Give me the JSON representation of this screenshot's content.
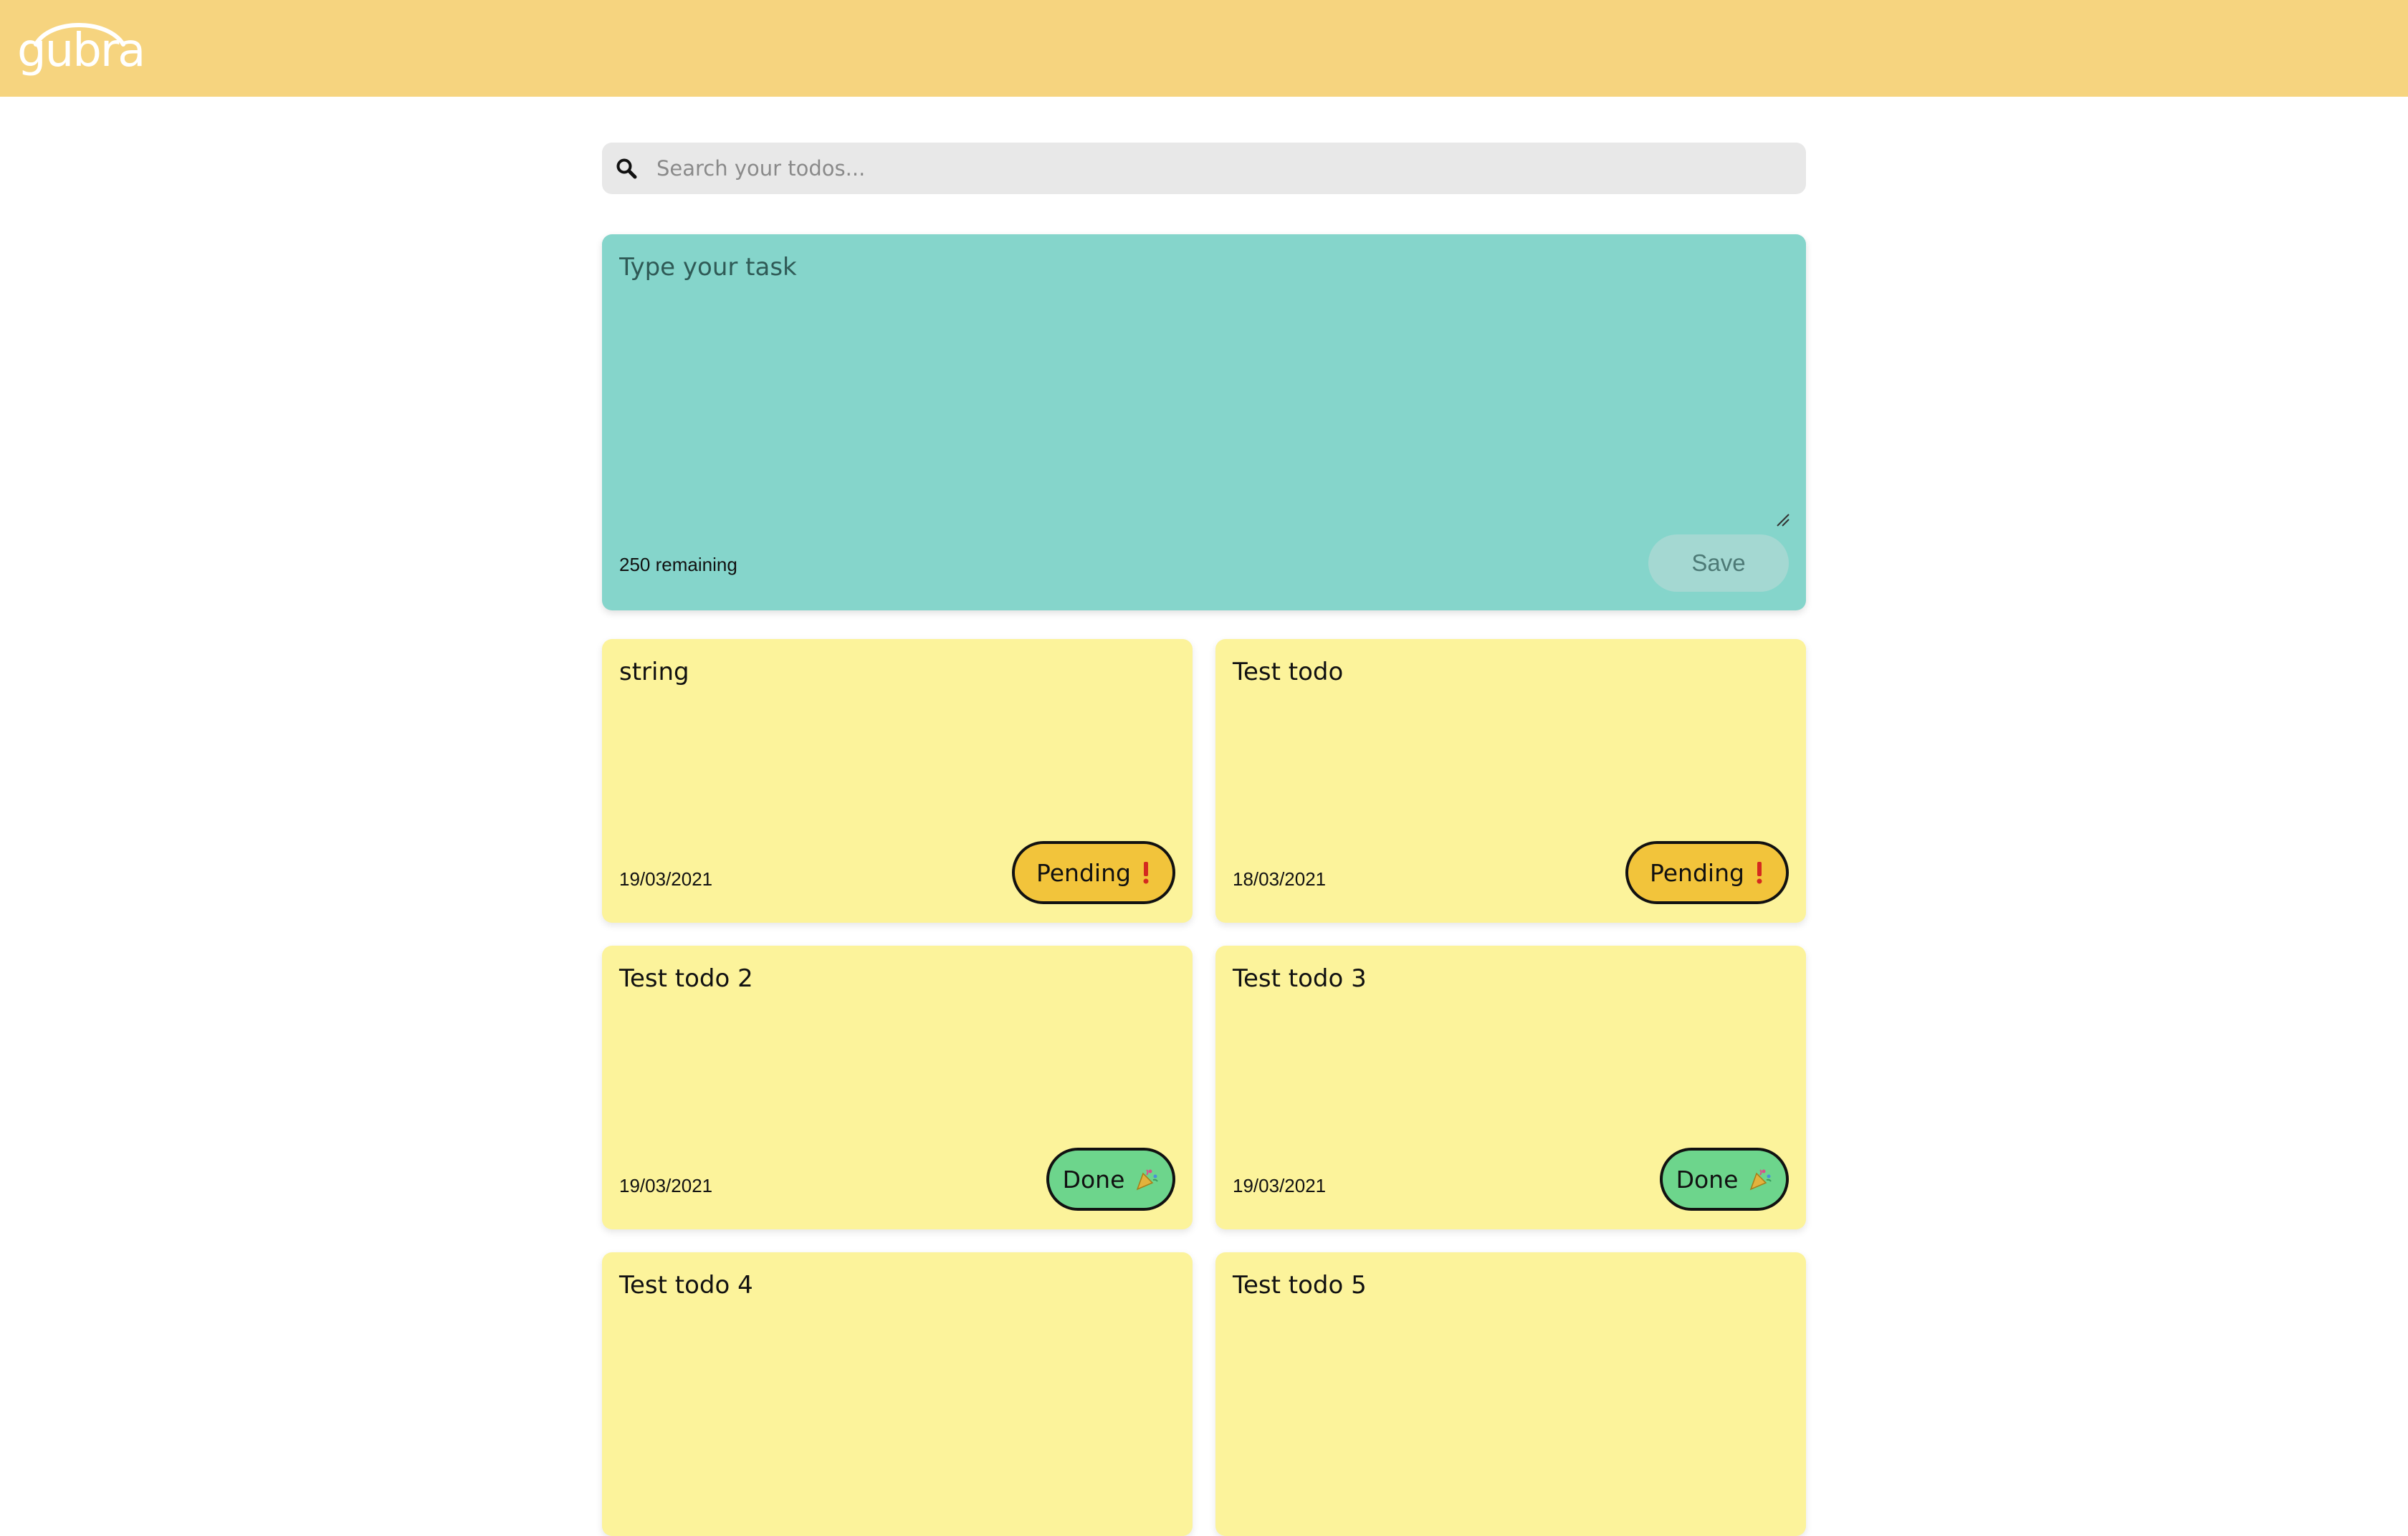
{
  "header": {
    "logo_text": "gubra",
    "colors": {
      "background": "#f6d47f",
      "logo": "#ffffff"
    }
  },
  "search": {
    "placeholder": "Search your todos...",
    "value": "",
    "icon": "search-icon"
  },
  "composer": {
    "placeholder": "Type your task",
    "value": "",
    "remaining_text": "250 remaining",
    "save_label": "Save",
    "background": "#85d5cb"
  },
  "todos": [
    {
      "title": "string",
      "date": "19/03/2021",
      "status": "Pending",
      "status_icon": "exclamation-icon"
    },
    {
      "title": "Test todo",
      "date": "18/03/2021",
      "status": "Pending",
      "status_icon": "exclamation-icon"
    },
    {
      "title": "Test todo 2",
      "date": "19/03/2021",
      "status": "Done",
      "status_icon": "party-popper-icon"
    },
    {
      "title": "Test todo 3",
      "date": "19/03/2021",
      "status": "Done",
      "status_icon": "party-popper-icon"
    },
    {
      "title": "Test todo 4",
      "date": "",
      "status": "",
      "status_icon": ""
    },
    {
      "title": "Test todo 5",
      "date": "",
      "status": "",
      "status_icon": ""
    }
  ],
  "colors": {
    "card": "#fcf39b",
    "pending": "#f2c43b",
    "done": "#6dd58c",
    "exclamation": "#d42a1f"
  }
}
